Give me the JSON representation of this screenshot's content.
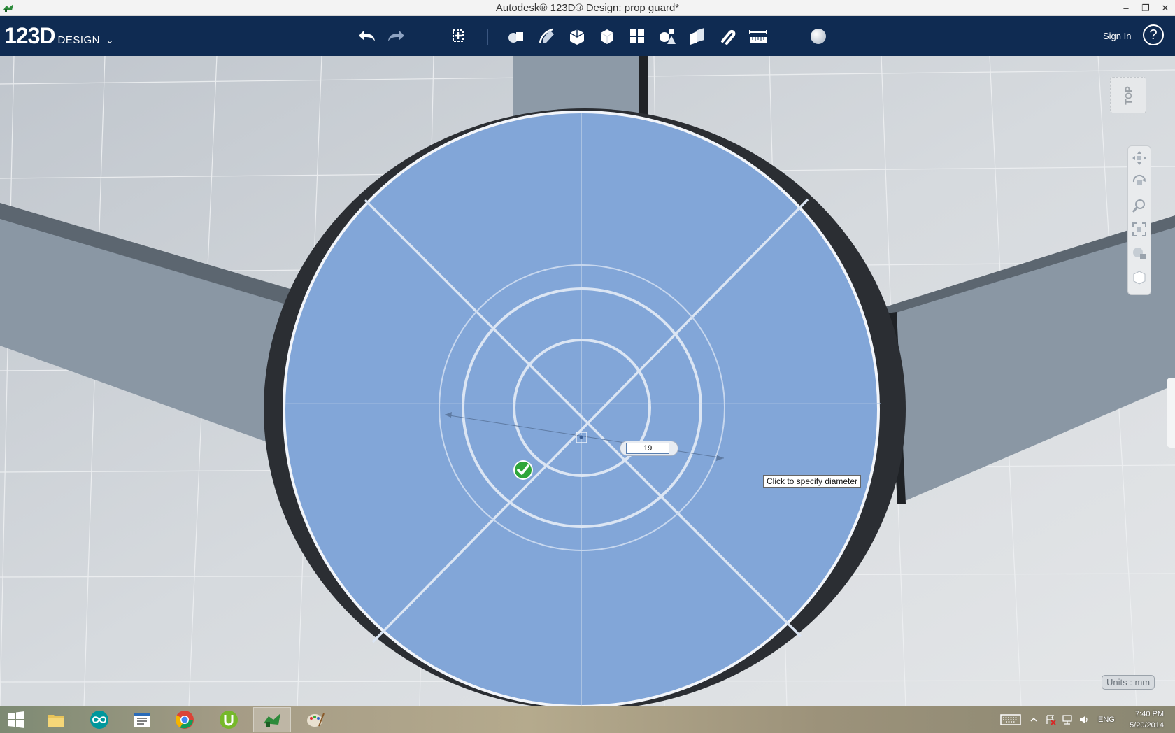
{
  "window": {
    "title": "Autodesk® 123D® Design: prop guard*",
    "minimize_glyph": "–",
    "restore_glyph": "❐",
    "close_glyph": "✕"
  },
  "brand": {
    "big": "123D",
    "small": "DESIGN",
    "chevron": "⌄"
  },
  "toolbar": {
    "tools": [
      {
        "name": "undo-icon"
      },
      {
        "name": "redo-icon"
      },
      {
        "name": "transform-icon"
      },
      {
        "name": "primitives-icon"
      },
      {
        "name": "sketch-icon"
      },
      {
        "name": "construct-icon"
      },
      {
        "name": "modify-icon"
      },
      {
        "name": "pattern-icon"
      },
      {
        "name": "grouping-icon"
      },
      {
        "name": "combine-icon"
      },
      {
        "name": "snap-icon"
      },
      {
        "name": "measure-icon"
      },
      {
        "name": "material-icon"
      }
    ],
    "sign_in": "Sign In",
    "help": "?"
  },
  "viewport": {
    "viewcube_label": "TOP",
    "tooltip": "Click to specify diameter",
    "diameter_value": "19",
    "units": "Units : mm",
    "nav_tools": [
      "pan-icon",
      "orbit-icon",
      "zoom-icon",
      "fit-icon",
      "view-mode-icon",
      "material-view-icon"
    ]
  },
  "taskbar": {
    "apps": [
      "start-icon",
      "file-explorer-icon",
      "arduino-icon",
      "notes-app-icon",
      "chrome-icon",
      "utorrent-icon",
      "123d-design-icon",
      "paint-icon"
    ],
    "language": "ENG",
    "time": "7:40 PM",
    "date": "5/20/2014"
  },
  "colors": {
    "toolbar_bg": "#0f2b52",
    "sketch_fill": "#82a6d8",
    "confirm_green": "#2fa63a"
  }
}
